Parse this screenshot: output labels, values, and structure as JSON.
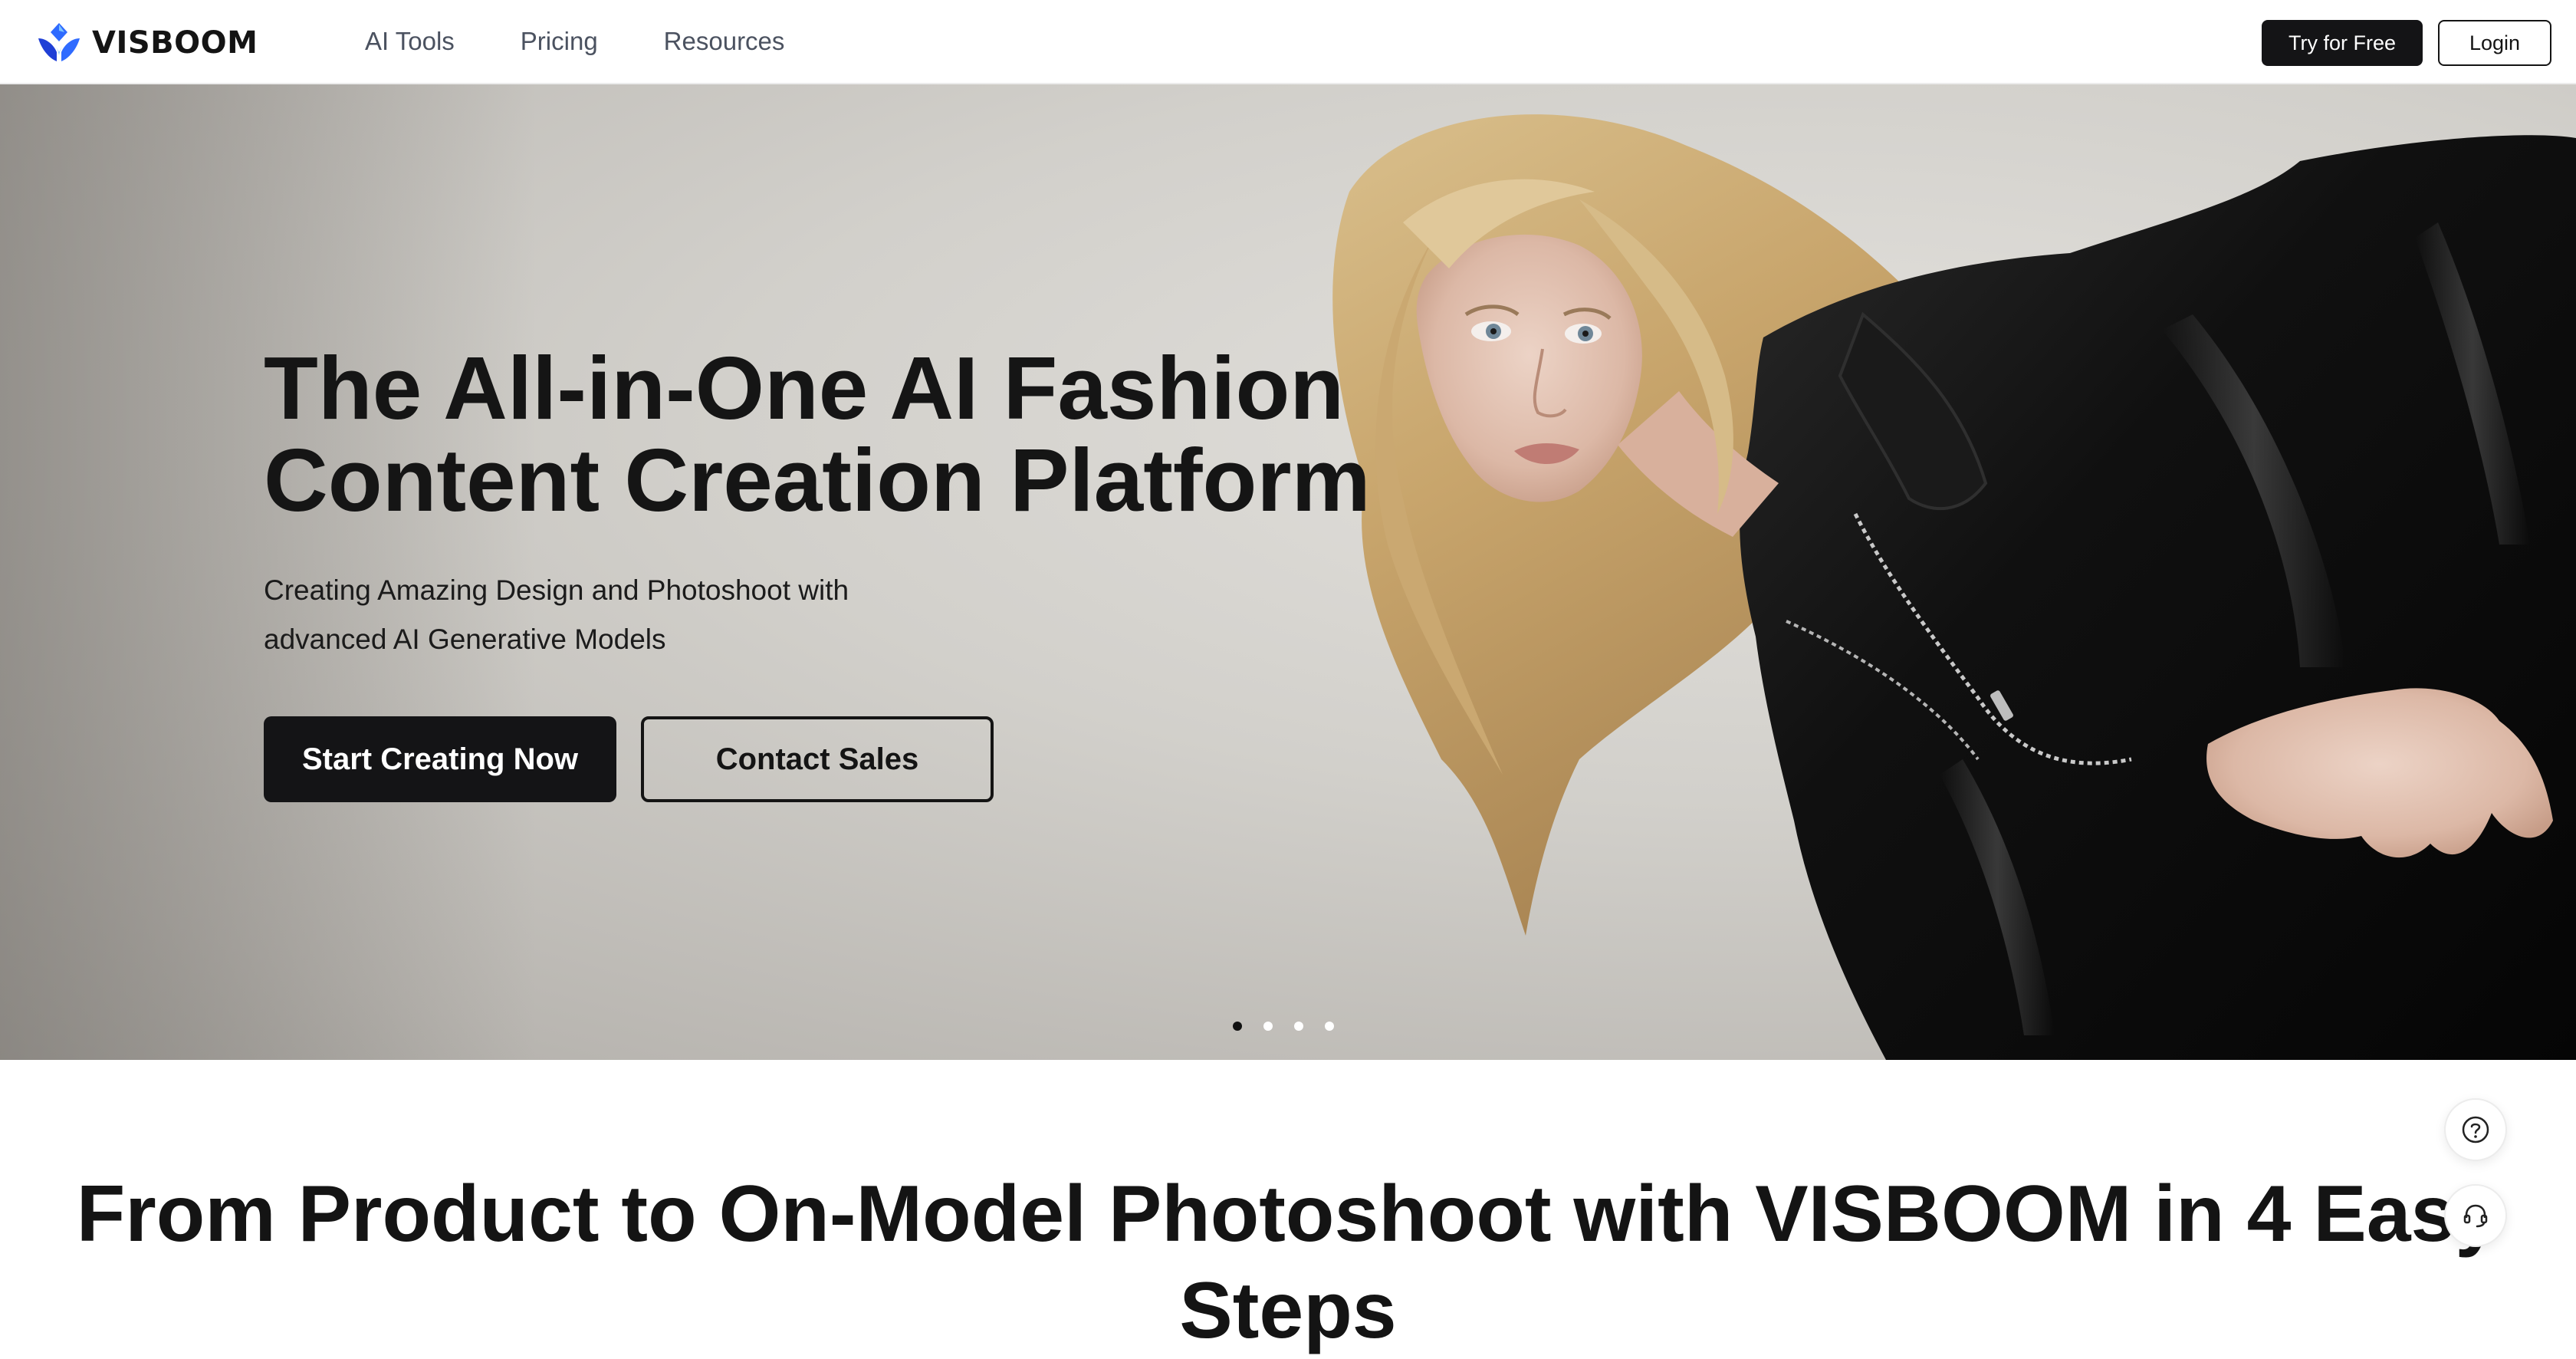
{
  "brand": {
    "name": "VISBOOM",
    "accent_colors": [
      "#2f6bff",
      "#1f3fd6",
      "#7cc4ff"
    ]
  },
  "nav": {
    "items": [
      {
        "label": "AI Tools"
      },
      {
        "label": "Pricing"
      },
      {
        "label": "Resources"
      }
    ]
  },
  "header_actions": {
    "try_label": "Try for Free",
    "login_label": "Login"
  },
  "hero": {
    "title": "The All-in-One AI Fashion Content Creation Platform",
    "subtitle": "Creating Amazing Design and Photoshoot with advanced AI Generative Models",
    "primary_cta": "Start Creating Now",
    "secondary_cta": "Contact Sales",
    "image_subject": "blonde model in black leather jacket",
    "carousel": {
      "slides": 4,
      "active_slide": 1
    }
  },
  "steps_section": {
    "title": "From Product to On-Model Photoshoot with VISBOOM in 4 Easy Steps"
  },
  "floating_actions": {
    "help_icon": "question-circle-icon",
    "support_icon": "headset-icon"
  }
}
